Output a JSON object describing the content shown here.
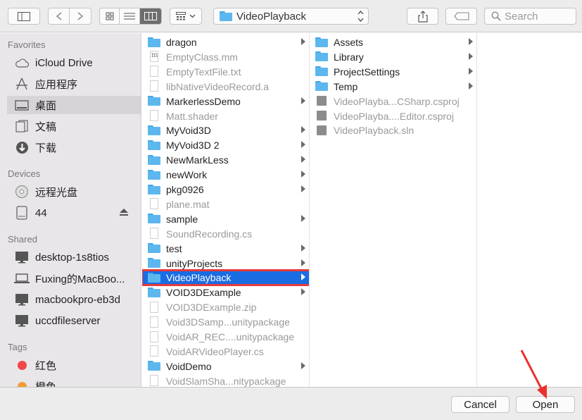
{
  "toolbar": {
    "path_label": "VideoPlayback",
    "search_placeholder": "Search"
  },
  "sidebar": {
    "sections": [
      {
        "title": "Favorites"
      },
      {
        "title": "Devices"
      },
      {
        "title": "Shared"
      },
      {
        "title": "Tags"
      }
    ],
    "favorites": [
      {
        "label": "iCloud Drive",
        "icon": "cloud-icon"
      },
      {
        "label": "应用程序",
        "icon": "applications-icon"
      },
      {
        "label": "桌面",
        "icon": "desktop-icon"
      },
      {
        "label": "文稿",
        "icon": "documents-icon"
      },
      {
        "label": "下载",
        "icon": "download-icon"
      }
    ],
    "devices": [
      {
        "label": "远程光盘",
        "icon": "disc-icon"
      },
      {
        "label": "44",
        "icon": "drive-icon"
      }
    ],
    "shared": [
      {
        "label": "desktop-1s8tios",
        "icon": "monitor-icon"
      },
      {
        "label": "Fuxing的MacBoo...",
        "icon": "laptop-icon"
      },
      {
        "label": "macbookpro-eb3d",
        "icon": "monitor-icon"
      },
      {
        "label": "uccdfileserver",
        "icon": "monitor-icon"
      }
    ],
    "tags": [
      {
        "label": "红色",
        "color": "#f0484a"
      },
      {
        "label": "橙色",
        "color": "#f39c35"
      }
    ]
  },
  "column1": [
    {
      "label": "dragon",
      "type": "folder"
    },
    {
      "label": "EmptyClass.mm",
      "type": "mm"
    },
    {
      "label": "EmptyTextFile.txt",
      "type": "doc"
    },
    {
      "label": "libNativeVideoRecord.a",
      "type": "doc"
    },
    {
      "label": "MarkerlessDemo",
      "type": "folder"
    },
    {
      "label": "Matt.shader",
      "type": "doc"
    },
    {
      "label": "MyVoid3D",
      "type": "folder"
    },
    {
      "label": "MyVoid3D 2",
      "type": "folder"
    },
    {
      "label": "NewMarkLess",
      "type": "folder"
    },
    {
      "label": "newWork",
      "type": "folder"
    },
    {
      "label": "pkg0926",
      "type": "folder"
    },
    {
      "label": "plane.mat",
      "type": "doc"
    },
    {
      "label": "sample",
      "type": "folder"
    },
    {
      "label": "SoundRecording.cs",
      "type": "doc"
    },
    {
      "label": "test",
      "type": "folder"
    },
    {
      "label": "unityProjects",
      "type": "folder"
    },
    {
      "label": "VideoPlayback",
      "type": "folder",
      "selected": true
    },
    {
      "label": "VOID3DExample",
      "type": "folder"
    },
    {
      "label": "VOID3DExample.zip",
      "type": "doc"
    },
    {
      "label": "Void3DSamp...unitypackage",
      "type": "doc"
    },
    {
      "label": "VoidAR_REC....unitypackage",
      "type": "doc"
    },
    {
      "label": "VoidARVideoPlayer.cs",
      "type": "doc"
    },
    {
      "label": "VoidDemo",
      "type": "folder"
    },
    {
      "label": "VoidSlamSha...nitypackage",
      "type": "doc"
    }
  ],
  "column2": [
    {
      "label": "Assets",
      "type": "folder"
    },
    {
      "label": "Library",
      "type": "folder"
    },
    {
      "label": "ProjectSettings",
      "type": "folder"
    },
    {
      "label": "Temp",
      "type": "folder"
    },
    {
      "label": "VideoPlayba...CSharp.csproj",
      "type": "gen"
    },
    {
      "label": "VideoPlayba....Editor.csproj",
      "type": "gen"
    },
    {
      "label": "VideoPlayback.sln",
      "type": "gen"
    }
  ],
  "buttons": {
    "cancel": "Cancel",
    "open": "Open"
  }
}
